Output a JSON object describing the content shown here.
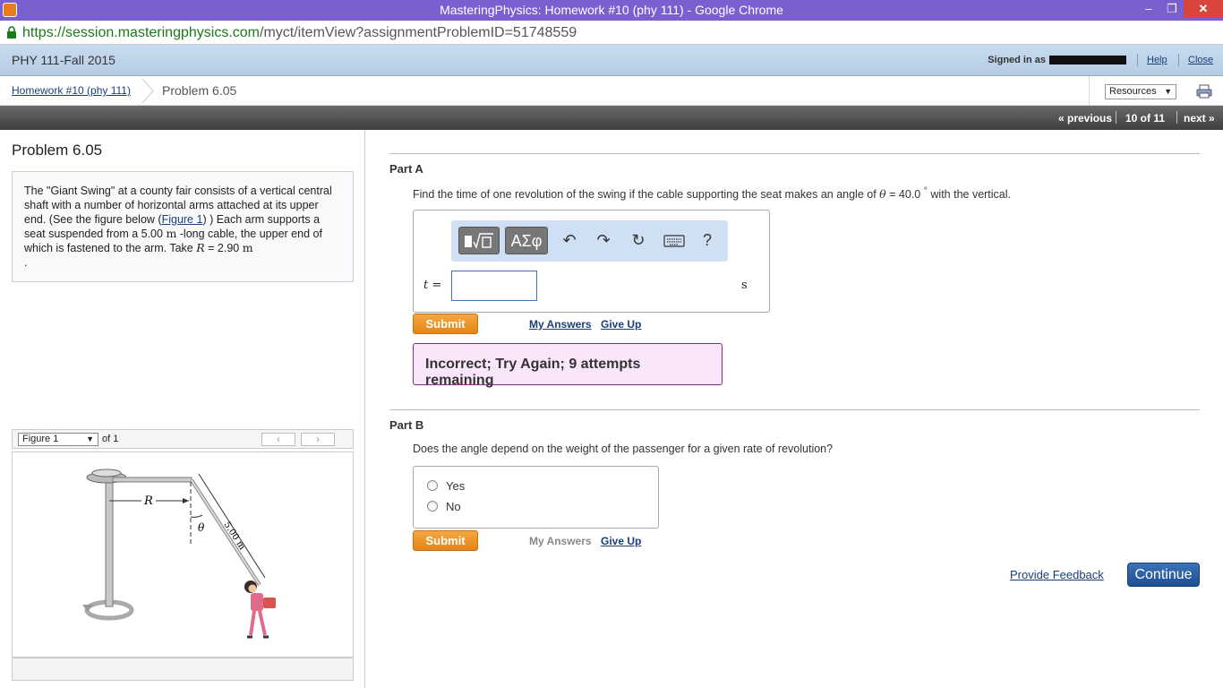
{
  "window": {
    "title": "MasteringPhysics: Homework #10 (phy 111) - Google Chrome"
  },
  "browser": {
    "url_host": "https://session.masteringphysics.com",
    "url_path": "/myct/itemView?assignmentProblemID=51748559"
  },
  "header": {
    "course": "PHY 111-Fall 2015",
    "signed_in": "Signed in as",
    "help": "Help",
    "close": "Close"
  },
  "breadcrumb": {
    "assignment": "Homework #10 (phy 111)",
    "problem": "Problem 6.05",
    "resources": "Resources"
  },
  "nav": {
    "previous": "« previous",
    "position": "10 of 11",
    "next": "next »"
  },
  "problem": {
    "title": "Problem 6.05",
    "text_1": "The \"Giant Swing\" at a county fair consists of a vertical central shaft with a number of horizontal arms attached at its upper end. (See the figure below (",
    "figure_link": "Figure 1",
    "text_2": ") ) Each arm supports a seat suspended from a 5.00 ",
    "unit_m1": "m",
    "text_3": " -long cable, the upper end of which is fastened to the arm. Take ",
    "var_R": "R",
    "text_4": " = 2.90 ",
    "unit_m2": "m",
    "text_5": "."
  },
  "figure": {
    "selector": "Figure 1",
    "of": "of 1",
    "prev": "‹",
    "next": "›",
    "label_R": "R",
    "label_theta": "θ",
    "label_len": "5.00 m"
  },
  "partA": {
    "label": "Part A",
    "q_1": "Find the time of one revolution of the swing if the cable supporting the seat makes an angle of ",
    "q_theta": "θ",
    "q_2": " = 40.0 ",
    "q_deg": "°",
    "q_3": " with the vertical.",
    "toolbar": {
      "greek": "ΑΣφ",
      "undo": "↶",
      "redo": "↷",
      "reset": "↻",
      "help": "?"
    },
    "var_label": "t",
    "eq": "=",
    "input_value": "",
    "unit": "s",
    "submit": "Submit",
    "my_answers": "My Answers",
    "give_up": "Give Up",
    "feedback": "Incorrect; Try Again; 9 attempts remaining"
  },
  "partB": {
    "label": "Part B",
    "question": "Does the angle depend on the weight of the passenger for a given rate of revolution?",
    "options": [
      "Yes",
      "No"
    ],
    "submit": "Submit",
    "my_answers": "My Answers",
    "give_up": "Give Up"
  },
  "footer": {
    "provide_feedback": "Provide Feedback",
    "continue": "Continue"
  },
  "colors": {
    "title_bar": "#7a5fd0",
    "submit": "#e48517",
    "continue": "#1e4f93",
    "feedback_bg": "#f9e6fb"
  }
}
